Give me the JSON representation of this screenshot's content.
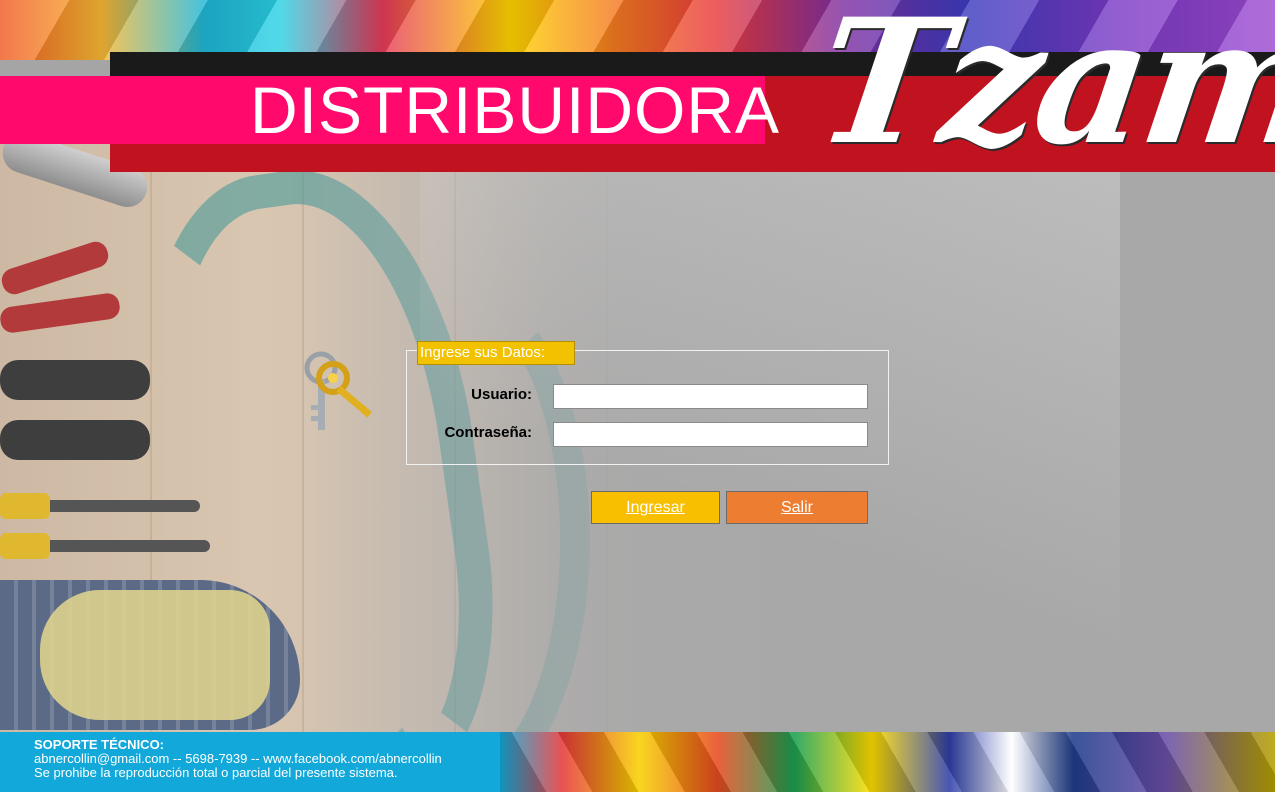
{
  "header": {
    "word": "DISTRIBUIDORA",
    "brand": "Tzamay"
  },
  "login": {
    "legend": "Ingrese sus Datos:",
    "user_label": "Usuario:",
    "user_value": "",
    "password_label": "Contraseña:",
    "password_value": "",
    "login_button": "Ingresar",
    "exit_button": "Salir"
  },
  "footer": {
    "title": "SOPORTE TÉCNICO:",
    "contact": "abnercollin@gmail.com -- 5698-7939 -- www.facebook.com/abnercollin",
    "notice": "Se prohibe la reproducción total o parcial del presente sistema."
  },
  "icons": {
    "key": "keys-icon"
  },
  "colors": {
    "legend_bg": "#f2c100",
    "login_button": "#f7bf00",
    "exit_button": "#ed7d31",
    "pink_band": "#ff0a6c",
    "red_band": "#c1121f",
    "footer_bg": "#12a8d9"
  }
}
